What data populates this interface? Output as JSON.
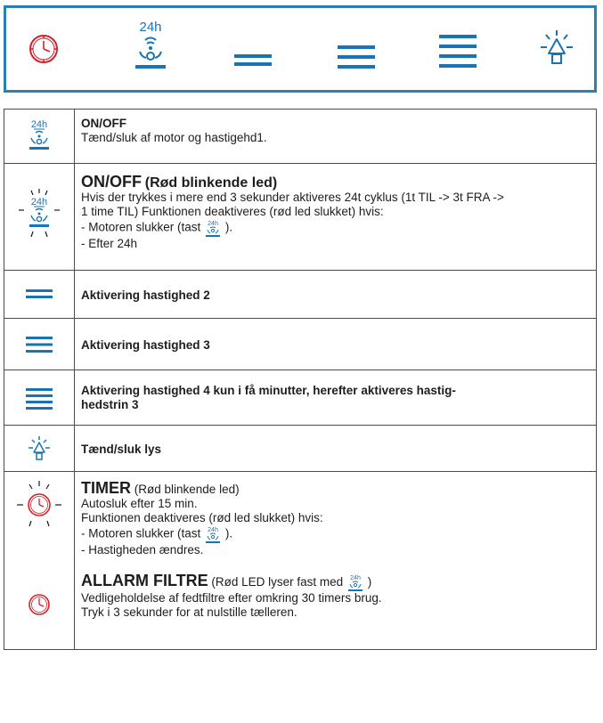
{
  "panel": {
    "buttons": [
      {
        "id": "timer",
        "icon": "clock-icon"
      },
      {
        "id": "power",
        "icon": "power-24h-icon",
        "label": "24h"
      },
      {
        "id": "speed2",
        "icon": "speed-2-lines-icon"
      },
      {
        "id": "speed3",
        "icon": "speed-3-lines-icon"
      },
      {
        "id": "speed4",
        "icon": "speed-4-lines-icon"
      },
      {
        "id": "light",
        "icon": "light-bulb-icon"
      }
    ]
  },
  "rows": {
    "onoff": {
      "title": "ON/OFF",
      "text": "Tænd/sluk af motor og hastigehd1."
    },
    "onoff_blink": {
      "title": "ON/OFF",
      "title_note": "(Rød blinkende led)",
      "line1": "Hvis der trykkes i mere end 3 sekunder aktiveres 24t cyklus (1t TIL -> 3t FRA ->",
      "line2": "1 time TIL) Funktionen deaktiveres (rød led slukket) hvis:",
      "line3_pre": "- Motoren slukker (tast",
      "line3_post": ").",
      "line4": "- Efter 24h"
    },
    "speed2": {
      "text": "Aktivering hastighed 2"
    },
    "speed3": {
      "text": "Aktivering hastighed 3"
    },
    "speed4": {
      "line1": "Aktivering hastighed 4 kun i få minutter, herefter aktiveres hastig-",
      "line2": "hedstrin 3"
    },
    "light": {
      "text": "Tænd/sluk lys"
    },
    "timer": {
      "title": "TIMER",
      "title_note": "(Rød blinkende led)",
      "line1": "Autosluk efter 15 min.",
      "line2": "Funktionen deaktiveres (rød led slukket) hvis:",
      "line3_pre": "- Motoren slukker (tast",
      "line3_post": ").",
      "line4": "- Hastigheden ændres."
    },
    "alarm": {
      "title": "ALLARM FILTRE",
      "title_note_pre": "(Rød LED lyser fast med",
      "title_note_post": ")",
      "line1": "Vedligeholdelse af fedtfiltre efter omkring 30 timers brug.",
      "line2": "Tryk i 3 sekunder for at nulstille tælleren."
    }
  },
  "colors": {
    "blue": "#1a73b4",
    "red": "#d6202a",
    "border": "#2a7fb5"
  }
}
